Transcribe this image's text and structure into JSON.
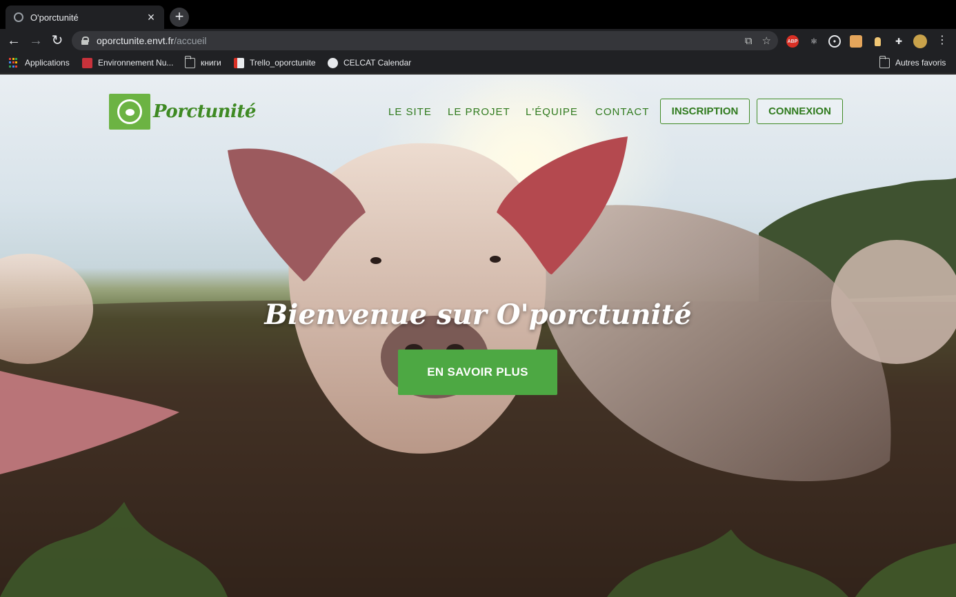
{
  "browser": {
    "tab_title": "O'porctunité",
    "url_host": "oporctunite.envt.fr",
    "url_path": "/accueil",
    "bookmarks": [
      {
        "label": "Applications"
      },
      {
        "label": "Environnement Nu..."
      },
      {
        "label": "книги"
      },
      {
        "label": "Trello_oporctunite"
      },
      {
        "label": "CELCAT Calendar"
      }
    ],
    "other_bookmarks": "Autres favoris",
    "extension_icons": [
      "abp-icon",
      "react-icon",
      "target-icon",
      "mail-icon",
      "bulb-icon",
      "puzzle-icon",
      "avatar-icon"
    ]
  },
  "site": {
    "logo_text": "Porctunité",
    "nav": {
      "items": [
        {
          "label": "LE SITE"
        },
        {
          "label": "LE PROJET"
        },
        {
          "label": "L'ÉQUIPE"
        },
        {
          "label": "CONTACT"
        }
      ],
      "signup": "INSCRIPTION",
      "login": "CONNEXION"
    },
    "hero": {
      "headline": "Bienvenue sur O'porctunité",
      "cta": "EN SAVOIR PLUS"
    },
    "colors": {
      "brand_green": "#3f8a24",
      "cta_green": "#4da843"
    }
  }
}
